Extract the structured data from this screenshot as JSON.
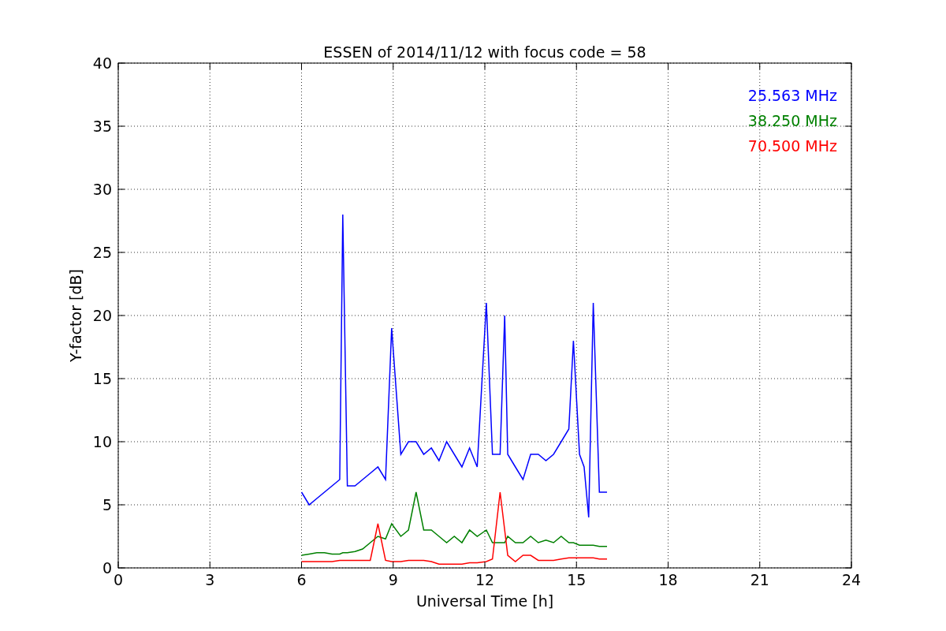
{
  "figure": {
    "chart_data": {
      "type": "line",
      "title": "ESSEN of 2014/11/12 with focus code = 58",
      "xlabel": "Universal Time [h]",
      "ylabel": "Y-factor [dB]",
      "x": [
        6,
        6.25,
        6.5,
        6.75,
        7,
        7.25,
        7.35,
        7.5,
        7.75,
        8,
        8.25,
        8.5,
        8.75,
        8.95,
        9.25,
        9.5,
        9.75,
        10,
        10.25,
        10.5,
        10.75,
        11,
        11.25,
        11.5,
        11.75,
        12.05,
        12.25,
        12.5,
        12.65,
        12.75,
        13,
        13.25,
        13.5,
        13.75,
        14,
        14.25,
        14.5,
        14.75,
        14.9,
        15.1,
        15.25,
        15.4,
        15.55,
        15.75,
        16
      ],
      "series": [
        {
          "name": "25.563 MHz",
          "color": "#0000ff",
          "values": [
            6,
            5,
            5.5,
            6,
            6.5,
            7,
            28,
            6.5,
            6.5,
            7,
            7.5,
            8,
            7,
            19,
            9,
            10,
            10,
            9,
            9.5,
            8.5,
            10,
            9,
            8,
            9.5,
            8,
            21,
            9,
            9,
            20,
            9,
            8,
            7,
            9,
            9,
            8.5,
            9,
            10,
            11,
            18,
            9,
            8,
            4,
            21,
            6,
            6
          ]
        },
        {
          "name": "38.250 MHz",
          "color": "#008000",
          "values": [
            1,
            1.1,
            1.2,
            1.2,
            1.1,
            1.1,
            1.2,
            1.2,
            1.3,
            1.5,
            2,
            2.5,
            2.3,
            3.5,
            2.5,
            3,
            6,
            3,
            3,
            2.5,
            2,
            2.5,
            2,
            3,
            2.5,
            3,
            2,
            2,
            2,
            2.5,
            2,
            2,
            2.5,
            2,
            2.2,
            2,
            2.5,
            2,
            2,
            1.8,
            1.8,
            1.8,
            1.8,
            1.7,
            1.7
          ]
        },
        {
          "name": "70.500 MHz",
          "color": "#ff0000",
          "values": [
            0.5,
            0.5,
            0.5,
            0.5,
            0.5,
            0.6,
            0.6,
            0.6,
            0.6,
            0.6,
            0.6,
            3.5,
            0.6,
            0.5,
            0.5,
            0.6,
            0.6,
            0.6,
            0.5,
            0.3,
            0.3,
            0.3,
            0.3,
            0.4,
            0.4,
            0.5,
            0.7,
            6,
            3,
            1,
            0.5,
            1,
            1,
            0.6,
            0.6,
            0.6,
            0.7,
            0.8,
            0.8,
            0.8,
            0.8,
            0.8,
            0.8,
            0.7,
            0.7
          ]
        }
      ],
      "xlim": [
        0,
        24
      ],
      "ylim": [
        0,
        40
      ],
      "xticks": [
        0,
        3,
        6,
        9,
        12,
        15,
        18,
        21,
        24
      ],
      "yticks": [
        0,
        5,
        10,
        15,
        20,
        25,
        30,
        35,
        40
      ],
      "grid": true
    }
  }
}
